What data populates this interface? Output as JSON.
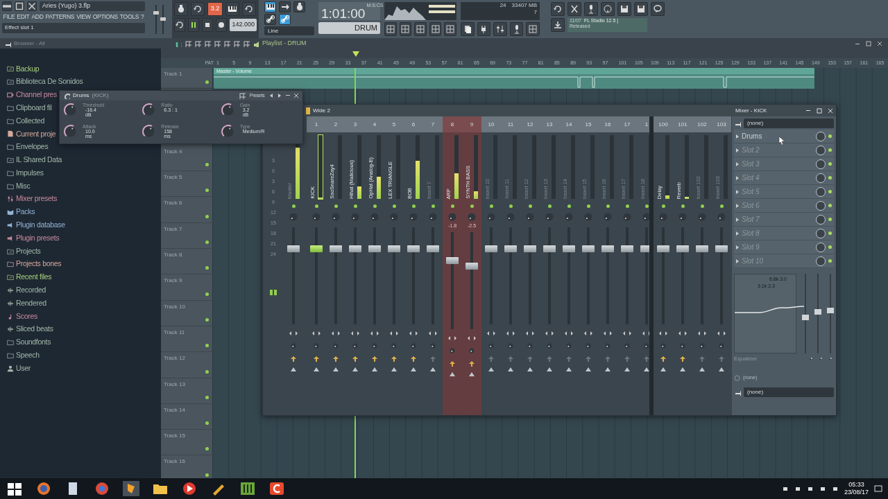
{
  "window": {
    "title": "Aries (Yugo) 3.flp"
  },
  "menu": [
    "FILE",
    "EDIT",
    "ADD",
    "PATTERNS",
    "VIEW",
    "OPTIONS",
    "TOOLS",
    "?"
  ],
  "hint_bar": "Effect slot 1",
  "master_sliders": [
    {
      "level": 0.75
    },
    {
      "level": 0.5
    }
  ],
  "transport": {
    "mode_label": "3.2",
    "mode_on": true,
    "playing": true,
    "tempo": "142.000",
    "snap": "Line",
    "time": "1:01:00",
    "time_unit": "M:S:CS",
    "pattern": "DRUM"
  },
  "monitor": {
    "polyphony": "24",
    "memory": "33407 MB",
    "cpu": "7"
  },
  "news": {
    "date": "11/07",
    "headline": "FL Studio 12.5 |",
    "status": "Released"
  },
  "browser": {
    "title": "Browser - All",
    "items": [
      {
        "label": "Backup",
        "kind": "linkfolder",
        "color": "#a9cf7a"
      },
      {
        "label": "Biblioteca De Sonidos",
        "kind": "linkfolder",
        "color": "#a3b9a9"
      },
      {
        "label": "Channel pres",
        "kind": "channel",
        "color": "#c98a9c"
      },
      {
        "label": "Clipboard fil",
        "kind": "folder",
        "color": "#a3b9a9"
      },
      {
        "label": "Collected",
        "kind": "folder",
        "color": "#a3b9a9"
      },
      {
        "label": "Current proje",
        "kind": "file",
        "color": "#d6a89a"
      },
      {
        "label": "Envelopes",
        "kind": "folder",
        "color": "#a3b9a9"
      },
      {
        "label": "IL Shared Data",
        "kind": "linkfolder",
        "color": "#a3b9a9"
      },
      {
        "label": "Impulses",
        "kind": "folder",
        "color": "#a3b9a9"
      },
      {
        "label": "Misc",
        "kind": "folder",
        "color": "#a3b9a9"
      },
      {
        "label": "Mixer presets",
        "kind": "sliders",
        "color": "#c98a9c"
      },
      {
        "label": "Packs",
        "kind": "box",
        "color": "#93b4d6"
      },
      {
        "label": "Plugin database",
        "kind": "plug",
        "color": "#93b4d6"
      },
      {
        "label": "Plugin presets",
        "kind": "plug",
        "color": "#c98a9c"
      },
      {
        "label": "Projects",
        "kind": "linkfolder",
        "color": "#a3b9a9"
      },
      {
        "label": "Projects bones",
        "kind": "folder",
        "color": "#d6a89a"
      },
      {
        "label": "Recent files",
        "kind": "linkfolder",
        "color": "#a9cf7a"
      },
      {
        "label": "Recorded",
        "kind": "wave",
        "color": "#a3b9a9"
      },
      {
        "label": "Rendered",
        "kind": "wave",
        "color": "#a3b9a9"
      },
      {
        "label": "Scores",
        "kind": "note",
        "color": "#c98a9c"
      },
      {
        "label": "Sliced beats",
        "kind": "wave",
        "color": "#a3b9a9"
      },
      {
        "label": "Soundfonts",
        "kind": "folder",
        "color": "#a3b9a9"
      },
      {
        "label": "Speech",
        "kind": "folder",
        "color": "#a3b9a9"
      },
      {
        "label": "User",
        "kind": "user",
        "color": "#a3b9a9"
      }
    ]
  },
  "playlist": {
    "title": "Playlist - DRUM",
    "pat_label": "PAT",
    "clip": "Master - Volume",
    "ruler": [
      "1",
      "5",
      "9",
      "13",
      "17",
      "21",
      "25",
      "29",
      "33",
      "37",
      "41",
      "45",
      "49",
      "53",
      "57",
      "61",
      "65",
      "69",
      "73",
      "77",
      "81",
      "85",
      "89",
      "93",
      "97",
      "101",
      "105",
      "109",
      "113",
      "117",
      "121",
      "125",
      "129",
      "133",
      "137",
      "141",
      "145",
      "149",
      "153",
      "157",
      "161",
      "165"
    ],
    "tracks": [
      "Track 1",
      "Track 4",
      "Track 5",
      "Track 6",
      "Track 7",
      "Track 8",
      "Track 9",
      "Track 10",
      "Track 11",
      "Track 12",
      "Track 13",
      "Track 14",
      "Track 15",
      "Track 16"
    ]
  },
  "effect_window": {
    "plugin": "Drums",
    "channel": "(KICK)",
    "presets": "Presets",
    "params": [
      {
        "label": "Threshold",
        "value": "-16.4",
        "unit": "dB"
      },
      {
        "label": "Ratio",
        "value": "6.3 : 1"
      },
      {
        "label": "Gain",
        "value": "3.2",
        "unit": "dB"
      },
      {
        "label": "Attack",
        "value": "10.0",
        "unit": "ms"
      },
      {
        "label": "Release",
        "value": "158",
        "unit": "ms"
      },
      {
        "label": "Type",
        "value": "Medium/R"
      }
    ]
  },
  "mixer": {
    "title": "Mixer - KICK",
    "preset": "Wide 2",
    "db_scale": [
      "3",
      "0",
      "3",
      "6",
      "9",
      "12",
      "15",
      "18",
      "21",
      "24"
    ],
    "inserts": [
      {
        "name": "Master",
        "kind": "master",
        "selected": false,
        "highlighted": false,
        "meter": {
          "level": 0.8
        },
        "fader": {
          "level": 0.8
        }
      },
      {
        "number": "1",
        "name": "KICK",
        "kind": "named",
        "selected": true,
        "highlighted": false,
        "meter": {
          "level": 0.02
        },
        "fader": {
          "level": 0.8
        }
      },
      {
        "number": "2",
        "name": "SsoSnareZay4",
        "kind": "named",
        "selected": false,
        "highlighted": false,
        "meter": {
          "level": 0.0
        },
        "fader": {
          "level": 0.8
        }
      },
      {
        "number": "3",
        "name": "Hihat (Malicious)",
        "kind": "named",
        "selected": false,
        "highlighted": false,
        "meter": {
          "level": 0.2
        },
        "fader": {
          "level": 0.8
        }
      },
      {
        "number": "4",
        "name": "OpHat (Analog-B)",
        "kind": "named",
        "selected": false,
        "highlighted": false,
        "meter": {
          "level": 0.35
        },
        "fader": {
          "level": 0.8
        }
      },
      {
        "number": "5",
        "name": "LEX TRIANGLE",
        "kind": "named",
        "selected": false,
        "highlighted": false,
        "meter": {
          "level": 0.0
        },
        "fader": {
          "level": 0.8
        }
      },
      {
        "number": "6",
        "name": "BOB",
        "kind": "named",
        "selected": false,
        "highlighted": false,
        "meter": {
          "level": 0.6
        },
        "fader": {
          "level": 0.8
        }
      },
      {
        "number": "7",
        "name": "Insert 7",
        "kind": "empty",
        "selected": false,
        "highlighted": false,
        "meter": {
          "level": 0.0
        },
        "fader": {
          "level": 0.8
        }
      },
      {
        "number": "8",
        "name": "ARP",
        "kind": "named",
        "selected": false,
        "highlighted": true,
        "meter": {
          "level": 0.4
        },
        "fader": {
          "level": 0.72
        },
        "reading": "-1.8"
      },
      {
        "number": "9",
        "name": "SYNTH BASS",
        "kind": "named",
        "selected": false,
        "highlighted": true,
        "meter": {
          "level": 0.12
        },
        "fader": {
          "level": 0.66
        },
        "reading": "-2.5"
      },
      {
        "number": "10",
        "name": "Insert 10",
        "kind": "empty",
        "selected": false,
        "highlighted": false,
        "meter": {
          "level": 0.0
        },
        "fader": {
          "level": 0.8
        }
      },
      {
        "number": "11",
        "name": "Insert 11",
        "kind": "empty",
        "selected": false,
        "highlighted": false,
        "meter": {
          "level": 0.0
        },
        "fader": {
          "level": 0.8
        }
      },
      {
        "number": "12",
        "name": "Insert 12",
        "kind": "empty",
        "selected": false,
        "highlighted": false,
        "meter": {
          "level": 0.0
        },
        "fader": {
          "level": 0.8
        }
      },
      {
        "number": "13",
        "name": "Insert 13",
        "kind": "empty",
        "selected": false,
        "highlighted": false,
        "meter": {
          "level": 0.0
        },
        "fader": {
          "level": 0.8
        }
      },
      {
        "number": "14",
        "name": "Insert 14",
        "kind": "empty",
        "selected": false,
        "highlighted": false,
        "meter": {
          "level": 0.0
        },
        "fader": {
          "level": 0.8
        }
      },
      {
        "number": "15",
        "name": "Insert 15",
        "kind": "empty",
        "selected": false,
        "highlighted": false,
        "meter": {
          "level": 0.0
        },
        "fader": {
          "level": 0.8
        }
      },
      {
        "number": "16",
        "name": "Insert 16",
        "kind": "empty",
        "selected": false,
        "highlighted": false,
        "meter": {
          "level": 0.0
        },
        "fader": {
          "level": 0.8
        }
      },
      {
        "number": "17",
        "name": "Insert 17",
        "kind": "empty",
        "selected": false,
        "highlighted": false,
        "meter": {
          "level": 0.0
        },
        "fader": {
          "level": 0.8
        }
      },
      {
        "number": "1",
        "name": "Insert 18",
        "kind": "empty",
        "selected": false,
        "highlighted": false,
        "meter": {
          "level": 0.0
        },
        "fader": {
          "level": 0.8
        }
      }
    ],
    "buses": [
      {
        "number": "100",
        "name": "Delay",
        "kind": "named",
        "selected": false,
        "highlighted": false,
        "meter": {
          "level": 0.05
        },
        "fader": {
          "level": 0.8
        }
      },
      {
        "number": "101",
        "name": "Reverb",
        "kind": "named",
        "selected": false,
        "highlighted": false,
        "meter": {
          "level": 0.03
        },
        "fader": {
          "level": 0.8
        }
      },
      {
        "number": "102",
        "name": "Insert 102",
        "kind": "empty",
        "selected": false,
        "highlighted": false,
        "meter": {
          "level": 0.0
        },
        "fader": {
          "level": 0.8
        }
      },
      {
        "number": "103",
        "name": "Insert 103",
        "kind": "empty",
        "selected": false,
        "highlighted": false,
        "meter": {
          "level": 0.0
        },
        "fader": {
          "level": 0.8
        }
      }
    ],
    "input": "(none)",
    "slots": [
      {
        "label": "Drums",
        "kind": "filled",
        "enabled": true
      },
      {
        "label": "Slot 2",
        "kind": "empty",
        "enabled": true
      },
      {
        "label": "Slot 3",
        "kind": "empty",
        "enabled": true
      },
      {
        "label": "Slot 4",
        "kind": "empty",
        "enabled": true
      },
      {
        "label": "Slot 5",
        "kind": "empty",
        "enabled": true
      },
      {
        "label": "Slot 6",
        "kind": "empty",
        "enabled": true
      },
      {
        "label": "Slot 7",
        "kind": "empty",
        "enabled": true
      },
      {
        "label": "Slot 8",
        "kind": "empty",
        "enabled": true
      },
      {
        "label": "Slot 9",
        "kind": "empty",
        "enabled": true
      },
      {
        "label": "Slot 10",
        "kind": "empty",
        "enabled": true
      }
    ],
    "eq": {
      "band_labels": [
        "6.8k 3.0",
        "3.1k 2.3"
      ],
      "title": "Equalizer",
      "sliders": [
        {
          "level": 0.45
        },
        {
          "level": 0.52
        },
        {
          "level": 0.54
        }
      ]
    },
    "sidechain": "(none)",
    "output": "(none)"
  },
  "taskbar": {
    "time": "05:33",
    "date": "23/08/17"
  }
}
